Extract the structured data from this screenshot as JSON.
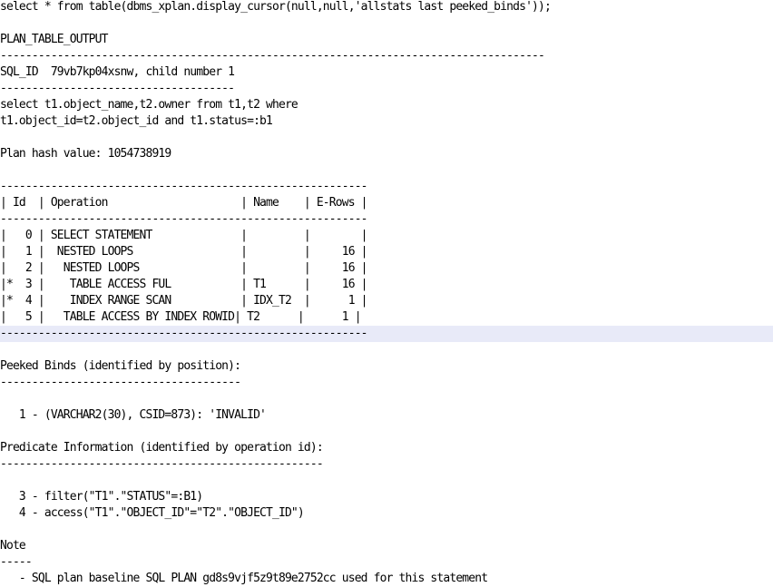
{
  "colors": {
    "background": "#ffffff",
    "text": "#000000",
    "highlight": "#e8eaf8"
  },
  "lines": [
    {
      "text": "select * from table(dbms_xplan.display_cursor(null,null,'allstats last peeked_binds'));"
    },
    {
      "text": ""
    },
    {
      "text": "PLAN_TABLE_OUTPUT"
    },
    {
      "text": "--------------------------------------------------------------------------------------"
    },
    {
      "text": "SQL_ID  79vb7kp04xsnw, child number 1"
    },
    {
      "text": "-------------------------------------"
    },
    {
      "text": "select t1.object_name,t2.owner from t1,t2 where"
    },
    {
      "text": "t1.object_id=t2.object_id and t1.status=:b1"
    },
    {
      "text": ""
    },
    {
      "text": "Plan hash value: 1054738919"
    },
    {
      "text": ""
    },
    {
      "text": "----------------------------------------------------------"
    },
    {
      "text": "| Id  | Operation                     | Name    | E-Rows |"
    },
    {
      "text": "----------------------------------------------------------"
    },
    {
      "text": "|   0 | SELECT STATEMENT              |         |        |"
    },
    {
      "text": "|   1 |  NESTED LOOPS                 |         |     16 |"
    },
    {
      "text": "|   2 |   NESTED LOOPS                |         |     16 |"
    },
    {
      "text": "|*  3 |    TABLE ACCESS FUL           | T1      |     16 |"
    },
    {
      "text": "|*  4 |    INDEX RANGE SCAN           | IDX_T2  |      1 |"
    },
    {
      "text": "|   5 |   TABLE ACCESS BY INDEX ROWID| T2      |      1 |"
    },
    {
      "text": "----------------------------------------------------------",
      "highlighted": true
    },
    {
      "text": ""
    },
    {
      "text": "Peeked Binds (identified by position):"
    },
    {
      "text": "--------------------------------------"
    },
    {
      "text": ""
    },
    {
      "text": "   1 - (VARCHAR2(30), CSID=873): 'INVALID'"
    },
    {
      "text": ""
    },
    {
      "text": "Predicate Information (identified by operation id):"
    },
    {
      "text": "---------------------------------------------------"
    },
    {
      "text": ""
    },
    {
      "text": "   3 - filter(\"T1\".\"STATUS\"=:B1)"
    },
    {
      "text": "   4 - access(\"T1\".\"OBJECT_ID\"=\"T2\".\"OBJECT_ID\")"
    },
    {
      "text": ""
    },
    {
      "text": "Note"
    },
    {
      "text": "-----"
    },
    {
      "text": "   - SQL plan baseline SQL PLAN gd8s9vjf5z9t89e2752cc used for this statement"
    }
  ]
}
